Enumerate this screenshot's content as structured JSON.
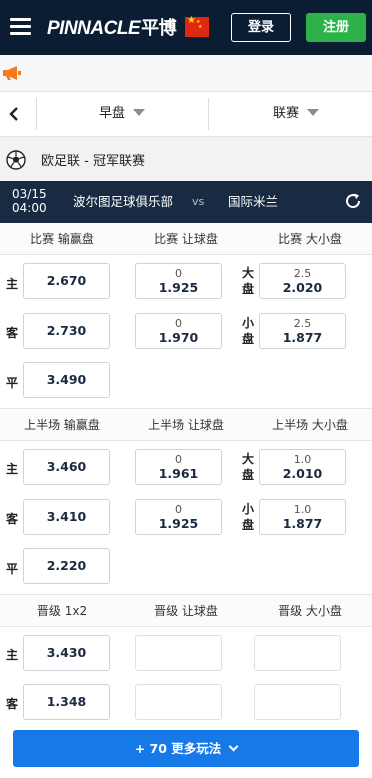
{
  "header": {
    "brand_latin": "PINNACLE",
    "brand_cn": "平博",
    "login_label": "登录",
    "register_label": "注册",
    "colors": {
      "bg": "#0b1d33",
      "register": "#2db24a"
    }
  },
  "filters": {
    "market": "早盘",
    "league": "联赛"
  },
  "league": {
    "name": "欧足联 - 冠军联赛"
  },
  "match": {
    "date": "03/15",
    "time": "04:00",
    "home": "波尔图足球俱乐部",
    "vs": "vs",
    "away": "国际米兰"
  },
  "sections": {
    "full": {
      "col1": "比赛 输赢盘",
      "col2": "比赛 让球盘",
      "col3": "比赛 大小盘",
      "home_label": "主",
      "away_label": "客",
      "draw_label": "平",
      "ml_home": "2.670",
      "ml_away": "2.730",
      "ml_draw": "3.490",
      "hdp_home_line": "0",
      "hdp_home_odd": "1.925",
      "hdp_away_line": "0",
      "hdp_away_odd": "1.970",
      "over_label": "大盘",
      "under_label": "小盘",
      "over_line": "2.5",
      "over_odd": "2.020",
      "under_line": "2.5",
      "under_odd": "1.877"
    },
    "half": {
      "col1": "上半场 输赢盘",
      "col2": "上半场 让球盘",
      "col3": "上半场 大小盘",
      "home_label": "主",
      "away_label": "客",
      "draw_label": "平",
      "ml_home": "3.460",
      "ml_away": "3.410",
      "ml_draw": "2.220",
      "hdp_home_line": "0",
      "hdp_home_odd": "1.961",
      "hdp_away_line": "0",
      "hdp_away_odd": "1.925",
      "over_label": "大盘",
      "under_label": "小盘",
      "over_line": "1.0",
      "over_odd": "2.010",
      "under_line": "1.0",
      "under_odd": "1.877"
    },
    "qualify": {
      "col1": "晋级 1x2",
      "col2": "晋级 让球盘",
      "col3": "晋级 大小盘",
      "home_label": "主",
      "away_label": "客",
      "home_odd": "3.430",
      "away_odd": "1.348"
    }
  },
  "more_button": {
    "label": "+ 70 更多玩法",
    "color": "#1679e8"
  }
}
